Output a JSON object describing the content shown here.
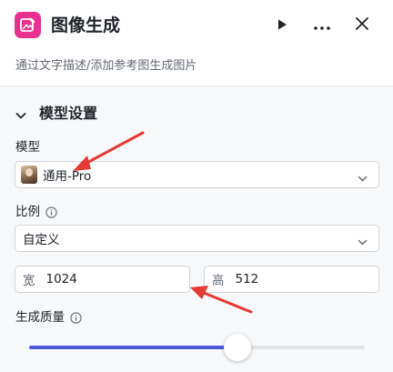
{
  "header": {
    "title": "图像生成",
    "subtitle": "通过文字描述/添加参考图生成图片",
    "app_icon": "image-edit-icon",
    "accent": "#e8318f"
  },
  "section": {
    "title": "模型设置"
  },
  "model": {
    "label": "模型",
    "value": "通用-Pro"
  },
  "ratio": {
    "label": "比例",
    "value": "自定义"
  },
  "size": {
    "width_prefix": "宽",
    "width_value": "1024",
    "height_prefix": "高",
    "height_value": "512"
  },
  "quality": {
    "label": "生成质量",
    "level_fraction": 0.62,
    "slider_color": "#4e5bd8"
  },
  "annotation_color": "#e53935"
}
